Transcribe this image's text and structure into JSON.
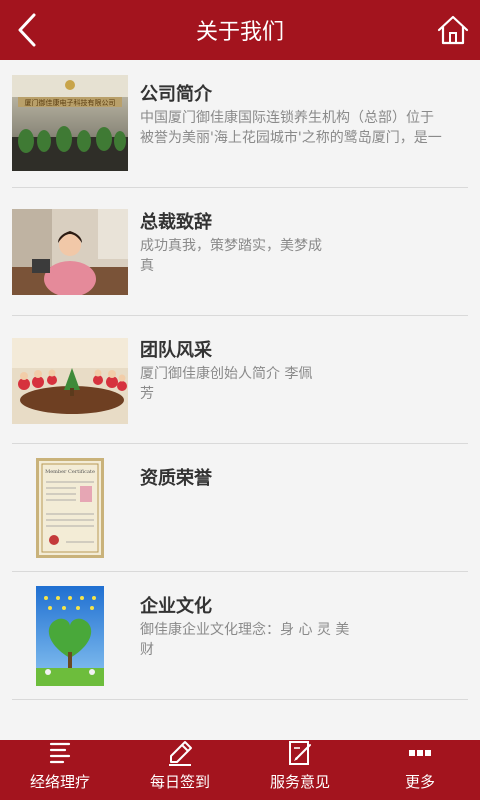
{
  "header": {
    "title": "关于我们",
    "back_icon": "chevron-left-icon",
    "home_icon": "home-icon"
  },
  "items": [
    {
      "title": "公司简介",
      "desc_lines": [
        "中国厦门御佳康国际连锁养生机构（总部）位于",
        "被誉为美丽'海上花园城市'之称的鹭岛厦门，是一"
      ],
      "image": "company-lobby-photo",
      "image_text": "厦门御佳康电子科技有限公司"
    },
    {
      "title": "总裁致辞",
      "desc_lines": [
        "成功真我，策梦踏实，美梦成",
        "真"
      ],
      "image": "president-photo"
    },
    {
      "title": "团队风采",
      "desc_lines": [
        "厦门御佳康创始人简介 李佩",
        "芳"
      ],
      "image": "team-meeting-photo"
    },
    {
      "title": "资质荣誉",
      "desc_lines": [],
      "image": "certificate-photo",
      "image_text": "Member Certificate"
    },
    {
      "title": "企业文化",
      "desc_lines": [
        "御佳康企业文化理念：身 心 灵 美",
        "财"
      ],
      "image": "heart-tree-poster"
    }
  ],
  "tabbar": [
    {
      "label": "经络理疗",
      "icon": "list-icon"
    },
    {
      "label": "每日签到",
      "icon": "pen-icon"
    },
    {
      "label": "服务意见",
      "icon": "feedback-icon"
    },
    {
      "label": "更多",
      "icon": "more-icon"
    }
  ],
  "colors": {
    "primary": "#a3141e",
    "background": "#f4f4f4"
  }
}
